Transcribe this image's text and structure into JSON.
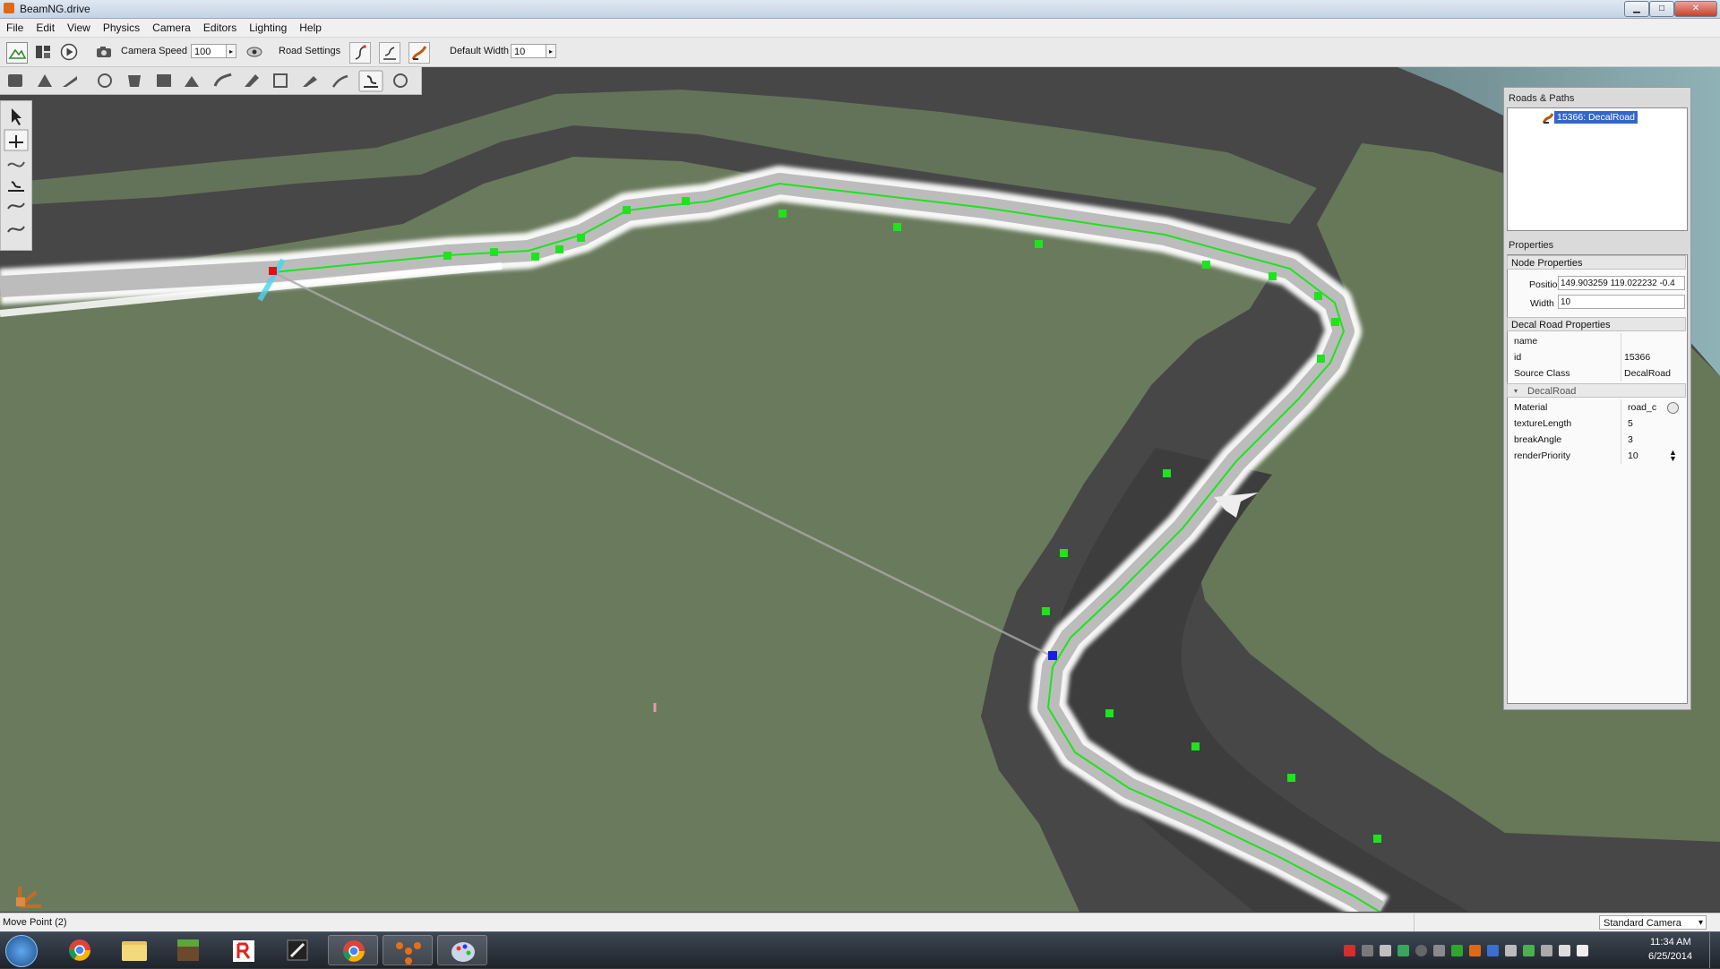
{
  "window": {
    "title": "BeamNG.drive",
    "minimize": "▁",
    "maximize": "□",
    "close": "✕"
  },
  "menubar": [
    "File",
    "Edit",
    "View",
    "Physics",
    "Camera",
    "Editors",
    "Lighting",
    "Help"
  ],
  "toolbar": {
    "camera_speed_label": "Camera Speed",
    "camera_speed_value": "100",
    "road_settings_label": "Road Settings",
    "default_width_label": "Default Width",
    "default_width_value": "10",
    "spin_arrow": "▸"
  },
  "roads_panel": {
    "title": "Roads & Paths",
    "items": [
      {
        "label": "15366: DecalRoad",
        "selected": true
      }
    ]
  },
  "properties_panel": {
    "title": "Properties",
    "node_section": "Node Properties",
    "position_label": "Position",
    "position_value": "149.903259 119.022232 -0.4",
    "width_label": "Width",
    "width_value": "10",
    "decal_section": "Decal Road Properties",
    "rows": [
      {
        "key": "name",
        "value": ""
      },
      {
        "key": "id",
        "value": "15366"
      },
      {
        "key": "Source Class",
        "value": "DecalRoad"
      }
    ],
    "group": "DecalRoad",
    "group_rows": [
      {
        "key": "Material",
        "value": "road_c"
      },
      {
        "key": "textureLength",
        "value": "5"
      },
      {
        "key": "breakAngle",
        "value": "3"
      },
      {
        "key": "renderPriority",
        "value": "10"
      }
    ]
  },
  "statusbar": {
    "left": "Move Point (2)",
    "camera_mode": "Standard Camera",
    "dropdown_arrow": "▾"
  },
  "taskbar": {
    "time": "11:34 AM",
    "date": "6/25/2014"
  },
  "icons": [
    "app-logo",
    "terrain",
    "layers",
    "play",
    "camera",
    "eye",
    "road-create",
    "road-edit",
    "road-decal",
    "select-arrow",
    "move-node",
    "globe",
    "spinner",
    "chrome",
    "folder",
    "minecraft",
    "roblox",
    "tool"
  ],
  "colors": {
    "road_node": "#1ee31e",
    "selected_node": "#1a1aee",
    "start_node": "#e01010",
    "selection": "#3267c9"
  }
}
